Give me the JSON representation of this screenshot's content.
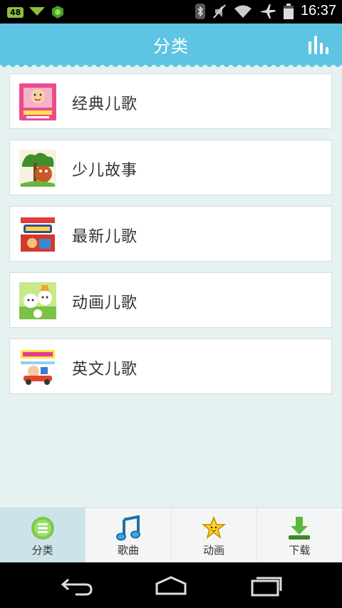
{
  "status_bar": {
    "badge": "48",
    "time": "16:37"
  },
  "header": {
    "title": "分类"
  },
  "categories": [
    {
      "label": "经典儿歌"
    },
    {
      "label": "少儿故事"
    },
    {
      "label": "最新儿歌"
    },
    {
      "label": "动画儿歌"
    },
    {
      "label": "英文儿歌"
    }
  ],
  "tabs": [
    {
      "label": "分类",
      "icon": "category-icon"
    },
    {
      "label": "歌曲",
      "icon": "music-note-icon"
    },
    {
      "label": "动画",
      "icon": "star-icon"
    },
    {
      "label": "下载",
      "icon": "download-icon"
    }
  ],
  "colors": {
    "header": "#5ec4e3",
    "active_tab": "#cde3ea",
    "background": "#e6f1f1"
  }
}
